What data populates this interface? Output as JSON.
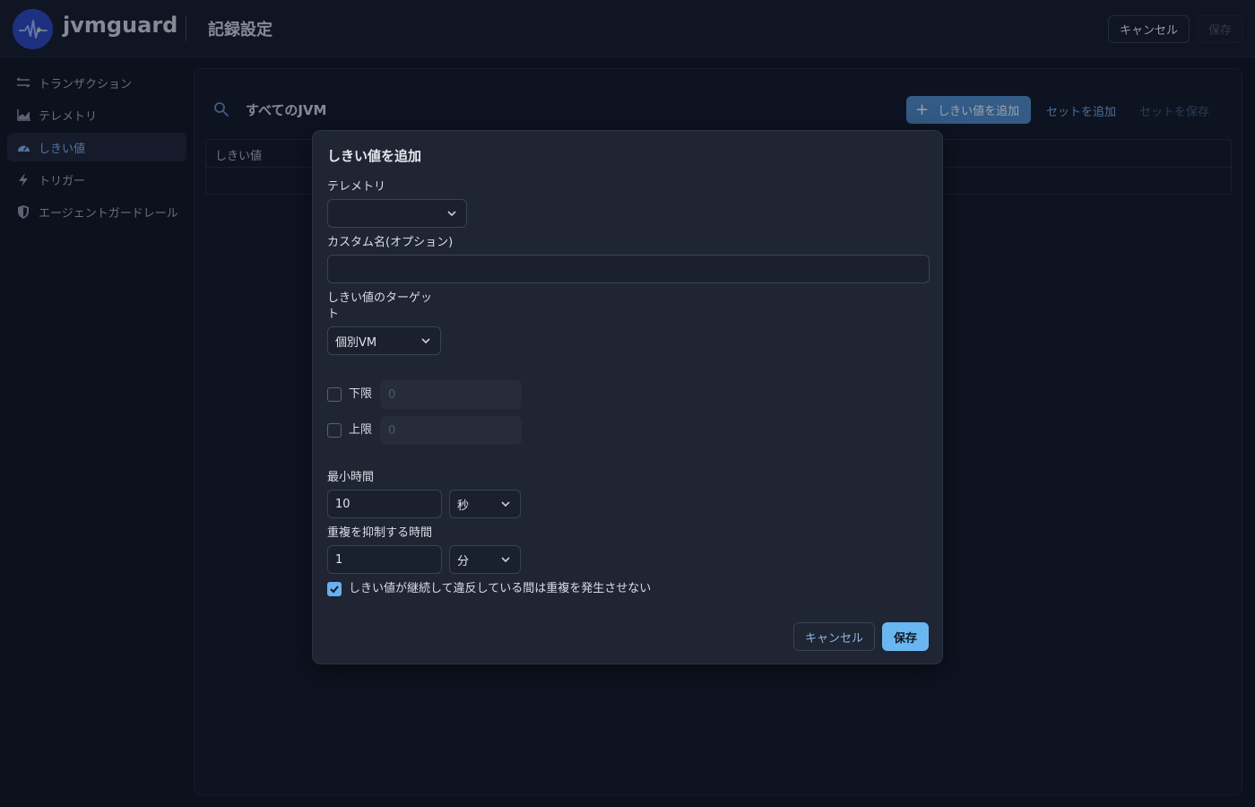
{
  "header": {
    "brand": "jvmguard",
    "title": "記録設定",
    "cancel_label": "キャンセル",
    "save_label": "保存"
  },
  "sidebar": {
    "items": [
      {
        "label": "トランザクション",
        "icon": "transactions-icon",
        "active": false
      },
      {
        "label": "テレメトリ",
        "icon": "telemetry-chart-icon",
        "active": false
      },
      {
        "label": "しきい値",
        "icon": "gauge-icon",
        "active": true
      },
      {
        "label": "トリガー",
        "icon": "lightning-icon",
        "active": false
      },
      {
        "label": "エージェントガードレール",
        "icon": "shield-icon",
        "active": false
      }
    ]
  },
  "main": {
    "scope_label": "すべてのJVM",
    "add_threshold_label": "しきい値を追加",
    "add_set_label": "セットを追加",
    "save_set_label": "セットを保存",
    "table_header": "しきい値"
  },
  "modal": {
    "title": "しきい値を追加",
    "telemetry_label": "テレメトリ",
    "telemetry_value": "",
    "custom_name_label": "カスタム名(オプション)",
    "custom_name_value": "",
    "target_label_line1": "しきい値のターゲッ",
    "target_label_line2": "ト",
    "target_value": "個別VM",
    "lower_label": "下限",
    "lower_value": "0",
    "lower_checked": false,
    "upper_label": "上限",
    "upper_value": "0",
    "upper_checked": false,
    "min_time_label": "最小時間",
    "min_time_value": "10",
    "min_time_unit": "秒",
    "suppress_label": "重複を抑制する時間",
    "suppress_value": "1",
    "suppress_unit": "分",
    "no_dup_label": "しきい値が継続して違反している間は重複を発生させない",
    "no_dup_checked": true,
    "cancel_label": "キャンセル",
    "save_label": "保存"
  },
  "colors": {
    "accent": "#6ab6f0",
    "primary_button": "#4a86c2",
    "background": "#0e1423",
    "modal_background": "#1f2533"
  }
}
